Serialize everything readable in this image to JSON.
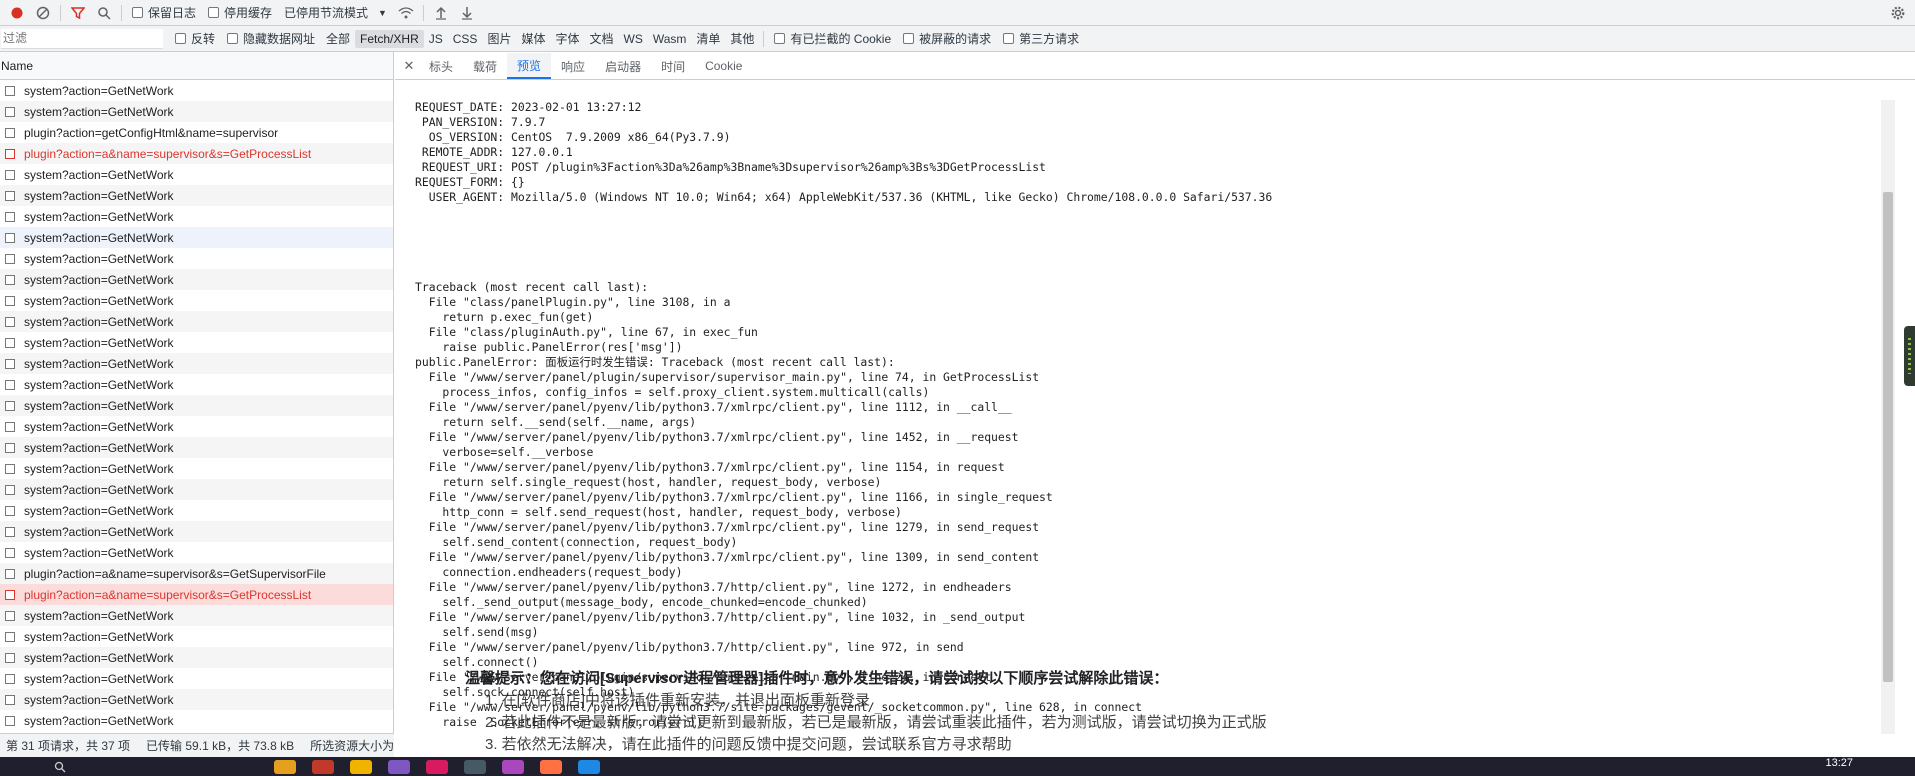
{
  "toolbar": {
    "preserve_log": "保留日志",
    "disable_cache": "停用缓存",
    "throttle": "已停用节流模式",
    "icons": [
      "record-icon",
      "clear-icon",
      "filter-icon",
      "search-icon",
      "wifi-settings-icon",
      "upload-icon",
      "download-icon",
      "gear-icon"
    ]
  },
  "filterbar": {
    "placeholder": "过滤",
    "invert": "反转",
    "hide_data_urls": "隐藏数据网址",
    "types": [
      "全部",
      "Fetch/XHR",
      "JS",
      "CSS",
      "图片",
      "媒体",
      "字体",
      "文档",
      "WS",
      "Wasm",
      "清单",
      "其他"
    ],
    "active_type": "Fetch/XHR",
    "blocked_cookies": "有已拦截的 Cookie",
    "blocked_requests": "被屏蔽的请求",
    "third_party": "第三方请求"
  },
  "requests": {
    "header": "Name",
    "items": [
      {
        "name": "system?action=GetNetWork",
        "state": ""
      },
      {
        "name": "system?action=GetNetWork",
        "state": ""
      },
      {
        "name": "plugin?action=getConfigHtml&name=supervisor",
        "state": ""
      },
      {
        "name": "plugin?action=a&name=supervisor&s=GetProcessList",
        "state": "err"
      },
      {
        "name": "system?action=GetNetWork",
        "state": ""
      },
      {
        "name": "system?action=GetNetWork",
        "state": ""
      },
      {
        "name": "system?action=GetNetWork",
        "state": ""
      },
      {
        "name": "system?action=GetNetWork",
        "state": "hov"
      },
      {
        "name": "system?action=GetNetWork",
        "state": ""
      },
      {
        "name": "system?action=GetNetWork",
        "state": ""
      },
      {
        "name": "system?action=GetNetWork",
        "state": ""
      },
      {
        "name": "system?action=GetNetWork",
        "state": ""
      },
      {
        "name": "system?action=GetNetWork",
        "state": ""
      },
      {
        "name": "system?action=GetNetWork",
        "state": ""
      },
      {
        "name": "system?action=GetNetWork",
        "state": ""
      },
      {
        "name": "system?action=GetNetWork",
        "state": ""
      },
      {
        "name": "system?action=GetNetWork",
        "state": ""
      },
      {
        "name": "system?action=GetNetWork",
        "state": ""
      },
      {
        "name": "system?action=GetNetWork",
        "state": ""
      },
      {
        "name": "system?action=GetNetWork",
        "state": ""
      },
      {
        "name": "system?action=GetNetWork",
        "state": ""
      },
      {
        "name": "system?action=GetNetWork",
        "state": ""
      },
      {
        "name": "system?action=GetNetWork",
        "state": ""
      },
      {
        "name": "plugin?action=a&name=supervisor&s=GetSupervisorFile",
        "state": ""
      },
      {
        "name": "plugin?action=a&name=supervisor&s=GetProcessList",
        "state": "err sel"
      },
      {
        "name": "system?action=GetNetWork",
        "state": ""
      },
      {
        "name": "system?action=GetNetWork",
        "state": ""
      },
      {
        "name": "system?action=GetNetWork",
        "state": ""
      },
      {
        "name": "system?action=GetNetWork",
        "state": ""
      },
      {
        "name": "system?action=GetNetWork",
        "state": ""
      },
      {
        "name": "system?action=GetNetWork",
        "state": ""
      }
    ]
  },
  "statusbar": {
    "requests": "第 31 项请求，共 37 项",
    "transferred": "已传输 59.1 kB，共 73.8 kB",
    "resources": "所选资源大小为"
  },
  "detail_tabs": {
    "items": [
      "标头",
      "载荷",
      "预览",
      "响应",
      "启动器",
      "时间",
      "Cookie"
    ],
    "active": "预览"
  },
  "preview_lines": [
    "REQUEST_DATE: 2023-02-01 13:27:12",
    " PAN_VERSION: 7.9.7",
    "  OS_VERSION: CentOS  7.9.2009 x86_64(Py3.7.9)",
    " REMOTE_ADDR: 127.0.0.1",
    " REQUEST_URI: POST /plugin%3Faction%3Da%26amp%3Bname%3Dsupervisor%26amp%3Bs%3DGetProcessList",
    "REQUEST_FORM: {}",
    "  USER_AGENT: Mozilla/5.0 (Windows NT 10.0; Win64; x64) AppleWebKit/537.36 (KHTML, like Gecko) Chrome/108.0.0.0 Safari/537.36",
    "",
    "",
    "",
    "",
    "",
    "Traceback (most recent call last):",
    "  File \"class/panelPlugin.py\", line 3108, in a",
    "    return p.exec_fun(get)",
    "  File \"class/pluginAuth.py\", line 67, in exec_fun",
    "    raise public.PanelError(res['msg'])",
    "public.PanelError: 面板运行时发生错误: Traceback (most recent call last):",
    "  File \"/www/server/panel/plugin/supervisor/supervisor_main.py\", line 74, in GetProcessList",
    "    process_infos, config_infos = self.proxy_client.system.multicall(calls)",
    "  File \"/www/server/panel/pyenv/lib/python3.7/xmlrpc/client.py\", line 1112, in __call__",
    "    return self.__send(self.__name, args)",
    "  File \"/www/server/panel/pyenv/lib/python3.7/xmlrpc/client.py\", line 1452, in __request",
    "    verbose=self.__verbose",
    "  File \"/www/server/panel/pyenv/lib/python3.7/xmlrpc/client.py\", line 1154, in request",
    "    return self.single_request(host, handler, request_body, verbose)",
    "  File \"/www/server/panel/pyenv/lib/python3.7/xmlrpc/client.py\", line 1166, in single_request",
    "    http_conn = self.send_request(host, handler, request_body, verbose)",
    "  File \"/www/server/panel/pyenv/lib/python3.7/xmlrpc/client.py\", line 1279, in send_request",
    "    self.send_content(connection, request_body)",
    "  File \"/www/server/panel/pyenv/lib/python3.7/xmlrpc/client.py\", line 1309, in send_content",
    "    connection.endheaders(request_body)",
    "  File \"/www/server/panel/pyenv/lib/python3.7/http/client.py\", line 1272, in endheaders",
    "    self._send_output(message_body, encode_chunked=encode_chunked)",
    "  File \"/www/server/panel/pyenv/lib/python3.7/http/client.py\", line 1032, in _send_output",
    "    self.send(msg)",
    "  File \"/www/server/panel/pyenv/lib/python3.7/http/client.py\", line 972, in send",
    "    self.connect()",
    "  File \"/www/server/panel/plugin/supervisor/supervisor_main.py\", line 24, in connect",
    "    self.sock.connect(self.host)",
    "  File \"/www/server/panel/pyenv/lib/python3.7/site-packages/gevent/_socketcommon.py\", line 628, in connect",
    "    raise _SocketError(err, strerror(err))",
    "ConnectionRefusedError: [Errno 111] Connection refused"
  ],
  "overlay": {
    "title": "温馨提示：您在访问[Supervisor进程管理器]插件时，意外发生错误，请尝试按以下顺序尝试解除此错误：",
    "lines": [
      "1. 在[软件商店]中将该插件重新安装，并退出面板重新登录",
      "2. 若此插件不是最新版，请尝试更新到最新版，若已是最新版，请尝试重装此插件，若为测试版，请尝试切换为正式版",
      "3. 若依然无法解决，请在此插件的问题反馈中提交问题，尝试联系官方寻求帮助"
    ]
  },
  "taskbar": {
    "clock": "13:27"
  }
}
